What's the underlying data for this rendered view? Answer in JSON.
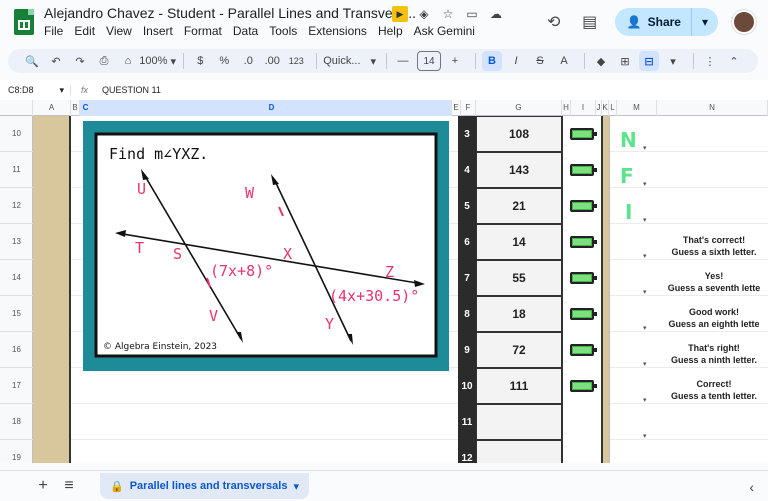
{
  "window": {
    "doc_title": "Alejandro Chavez - Student - Parallel Lines and Transvers...",
    "menu": [
      "File",
      "Edit",
      "View",
      "Insert",
      "Format",
      "Data",
      "Tools",
      "Extensions",
      "Help",
      "Ask Gemini"
    ],
    "share_label": "Share"
  },
  "toolbar": {
    "zoom": "100%",
    "currency": "$",
    "percent": "%",
    "dec_decrease": ".0",
    "dec_increase": ".00",
    "number_format": "123",
    "font": "Quick...",
    "font_size": "14",
    "bold": "B",
    "italic": "I",
    "strike": "S",
    "text_color": "A"
  },
  "formula_bar": {
    "name_box": "C8:D8",
    "fx": "fx",
    "value": "QUESTION 11"
  },
  "columns": [
    "A",
    "B",
    "C",
    "D",
    "E",
    "F",
    "G",
    "H",
    "I",
    "J",
    "K",
    "L",
    "M",
    "N"
  ],
  "rows": [
    "10",
    "11",
    "12",
    "13",
    "14",
    "15",
    "16",
    "17",
    "18",
    "19"
  ],
  "question_image": {
    "prompt": "Find m∠YXZ.",
    "labels": {
      "U": "U",
      "W": "W",
      "T": "T",
      "S": "S",
      "X": "X",
      "Z": "Z",
      "V": "V",
      "Y": "Y"
    },
    "expr1": "(7x+8)°",
    "expr2": "(4x+30.5)°",
    "credit": "© Algebra Einstein, 2023"
  },
  "answers": [
    {
      "num": "3",
      "value": "108",
      "battery": true
    },
    {
      "num": "4",
      "value": "143",
      "battery": true
    },
    {
      "num": "5",
      "value": "21",
      "battery": true
    },
    {
      "num": "6",
      "value": "14",
      "battery": true
    },
    {
      "num": "7",
      "value": "55",
      "battery": true
    },
    {
      "num": "8",
      "value": "18",
      "battery": true
    },
    {
      "num": "9",
      "value": "72",
      "battery": true
    },
    {
      "num": "10",
      "value": "111",
      "battery": true
    },
    {
      "num": "11",
      "value": "",
      "battery": false
    },
    {
      "num": "12",
      "value": "",
      "battery": false
    }
  ],
  "letters": [
    "N",
    "F",
    "I"
  ],
  "feedback": [
    {
      "line1": "That's correct!",
      "line2": "Guess a sixth letter."
    },
    {
      "line1": "Yes!",
      "line2": "Guess a seventh lette"
    },
    {
      "line1": "Good work!",
      "line2": "Guess an eighth lette"
    },
    {
      "line1": "That's right!",
      "line2": "Guess a ninth letter."
    },
    {
      "line1": "Correct!",
      "line2": "Guess a tenth letter."
    }
  ],
  "sheet_tab": {
    "label": "Parallel lines and transversals"
  },
  "colors": {
    "accent": "#0b57d0",
    "share_bg": "#c2e7ff",
    "teal": "#1e8c98",
    "tan": "#d8c69c",
    "letter_green": "#5ee38d",
    "label_pink": "#e8336d"
  }
}
